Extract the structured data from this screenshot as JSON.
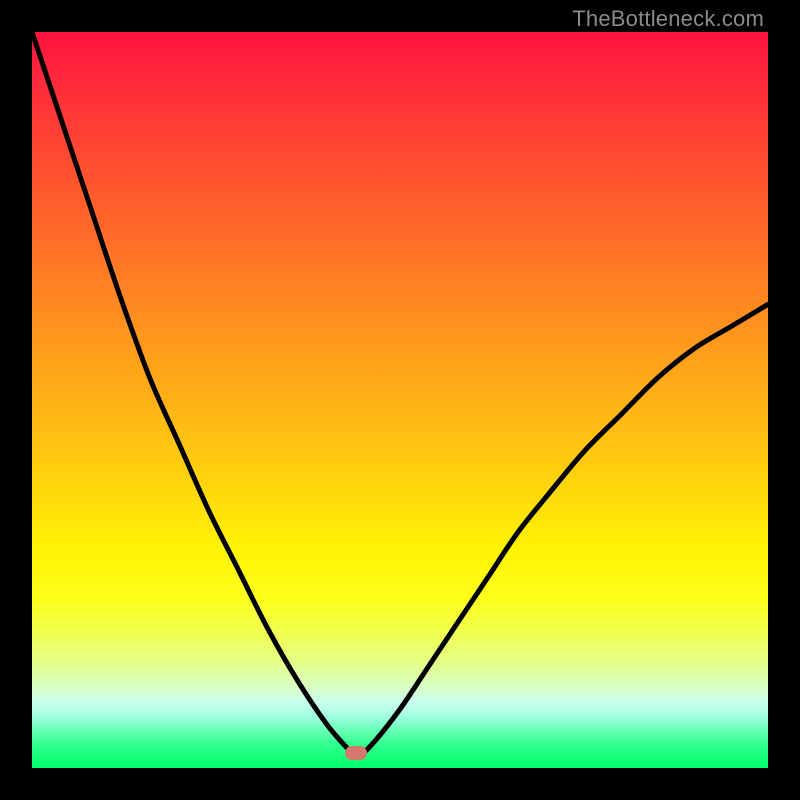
{
  "watermark": "TheBottleneck.com",
  "marker": {
    "x_pct": 44.0,
    "y_pct": 98.0
  },
  "chart_data": {
    "type": "line",
    "title": "",
    "xlabel": "",
    "ylabel": "",
    "xlim": [
      0,
      100
    ],
    "ylim": [
      0,
      100
    ],
    "series": [
      {
        "name": "left-branch",
        "x": [
          0.0,
          4.0,
          8.0,
          12.0,
          16.0,
          20.0,
          24.0,
          28.0,
          32.0,
          36.0,
          40.0,
          43.0,
          44.0
        ],
        "values": [
          0.0,
          12.0,
          24.0,
          36.0,
          47.0,
          56.0,
          65.0,
          73.0,
          81.0,
          88.0,
          94.0,
          97.5,
          98.5
        ]
      },
      {
        "name": "right-branch",
        "x": [
          44.0,
          46.0,
          50.0,
          54.0,
          58.0,
          62.0,
          66.0,
          70.0,
          75.0,
          80.0,
          85.0,
          90.0,
          95.0,
          100.0
        ],
        "values": [
          98.5,
          97.0,
          92.0,
          86.0,
          80.0,
          74.0,
          68.0,
          63.0,
          57.0,
          52.0,
          47.0,
          43.0,
          40.0,
          37.0
        ]
      }
    ],
    "annotations": [
      {
        "text": "TheBottleneck.com",
        "position": "top-right"
      }
    ]
  }
}
